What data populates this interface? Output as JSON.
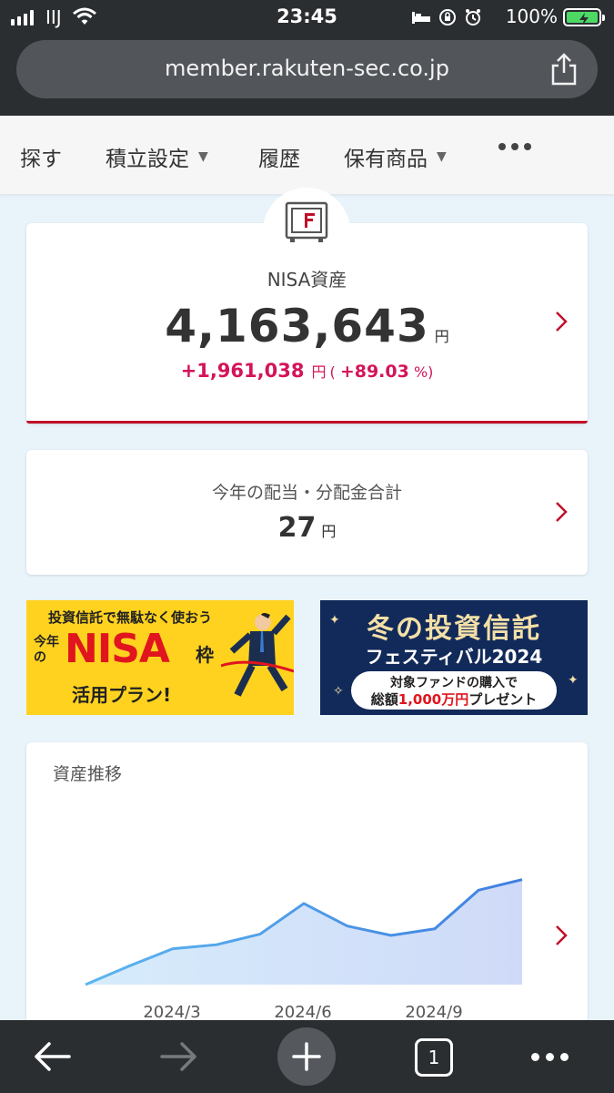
{
  "status_bar": {
    "carrier": "IIJ",
    "time": "23:45",
    "battery": "100%"
  },
  "browser": {
    "url": "member.rakuten-sec.co.jp",
    "tab_count": "1"
  },
  "nav": {
    "items": [
      {
        "label": "探す"
      },
      {
        "label": "積立設定"
      },
      {
        "label": "履歴"
      },
      {
        "label": "保有商品"
      }
    ]
  },
  "nisa": {
    "title": "NISA資産",
    "total": "4,163,643",
    "total_unit": "円",
    "gain": "+1,961,038",
    "gain_unit": "円",
    "gain_open": "(",
    "gain_pct": "+89.03",
    "gain_pct_close": "%)"
  },
  "dividend": {
    "label": "今年の配当・分配金合計",
    "value": "27",
    "unit": "円"
  },
  "banners": {
    "left": {
      "line1": "投資信託で無駄なく使おう",
      "prefix": "今年の",
      "nisa": "NISA",
      "waku": "枠",
      "line3": "活用プラン!"
    },
    "right": {
      "line1": "冬の投資信託",
      "line2": "フェスティバル2024",
      "line3": "対象ファンドの購入で",
      "line4a": "総額",
      "line4b": "1,000万円",
      "line4c": "プレゼント"
    }
  },
  "chart": {
    "title": "資産推移"
  },
  "chart_data": {
    "type": "area",
    "title": "資産推移",
    "x_ticks": [
      "2024/3",
      "2024/6",
      "2024/9"
    ],
    "values": [
      0.0,
      0.14,
      0.27,
      0.3,
      0.38,
      0.61,
      0.44,
      0.37,
      0.42,
      0.71,
      0.79
    ],
    "color": "#4a90e2"
  }
}
